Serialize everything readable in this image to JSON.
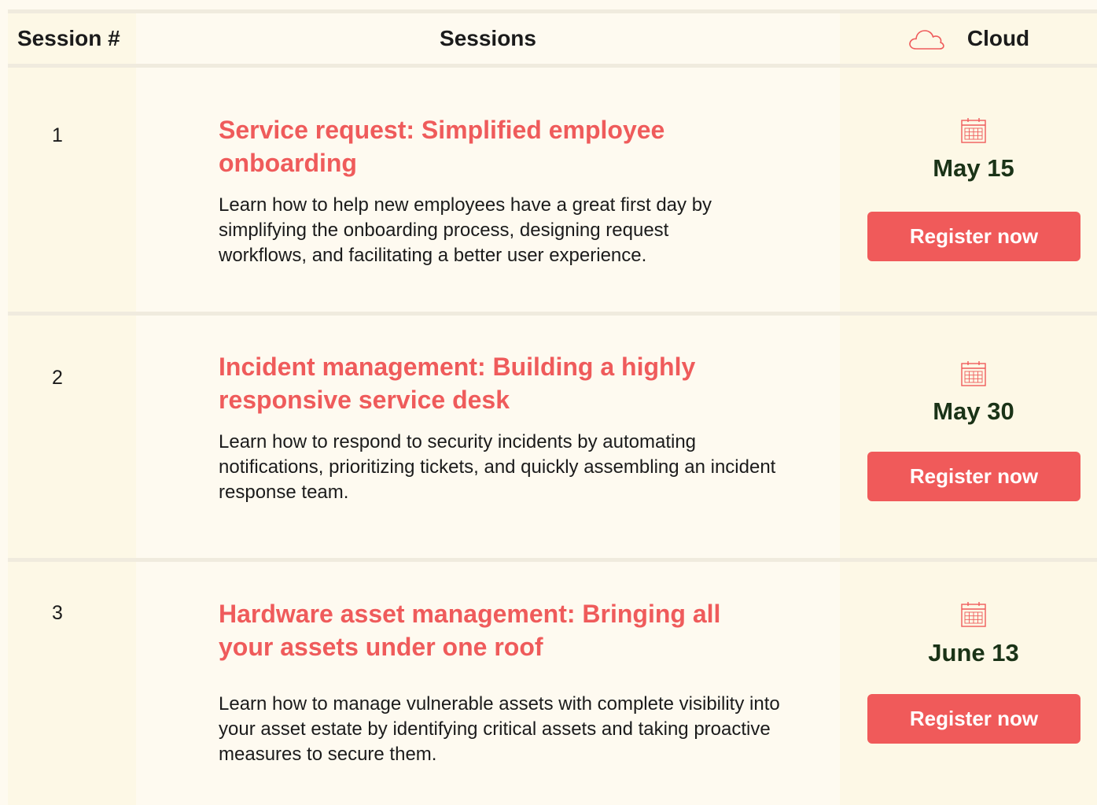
{
  "header": {
    "session_num_label": "Session #",
    "sessions_label": "Sessions",
    "cloud_label": "Cloud",
    "cloud_icon": "cloud-icon"
  },
  "colors": {
    "accent": "#ef5b5b",
    "date_text": "#1a3317",
    "background": "#fefaf0",
    "column_tint": "#fdf8e6"
  },
  "sessions": [
    {
      "number": "1",
      "title": "Service request: Simplified employee onboarding",
      "description": "Learn how to help new employees have a great first day by simplifying the onboarding process, designing request workflows, and facilitating a better user experience.",
      "date": "May 15",
      "button": "Register now",
      "icon": "calendar-icon"
    },
    {
      "number": "2",
      "title": "Incident management: Building a highly responsive service desk",
      "description": "Learn how to respond to security incidents by automating notifications, prioritizing tickets, and quickly assembling an incident response team.",
      "date": "May 30",
      "button": "Register now",
      "icon": "calendar-icon"
    },
    {
      "number": "3",
      "title": "Hardware asset management: Bringing all your assets under one roof",
      "description": "Learn how to manage vulnerable assets with complete visibility into your asset estate by identifying critical assets and taking proactive measures to secure them.",
      "date": "June 13",
      "button": "Register now",
      "icon": "calendar-icon"
    }
  ]
}
